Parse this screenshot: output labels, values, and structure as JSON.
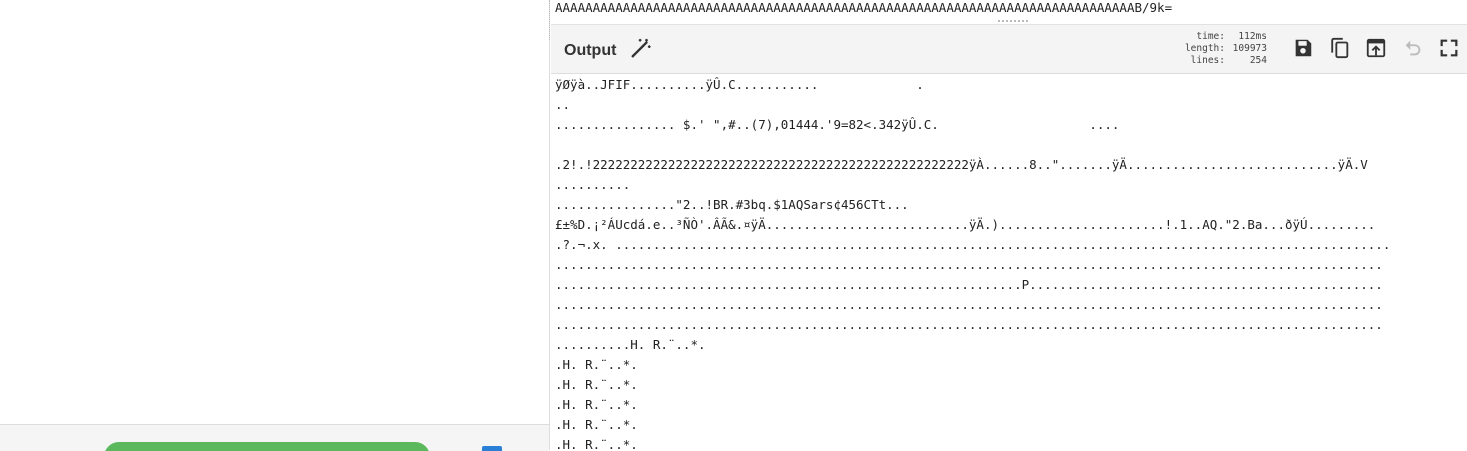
{
  "input": {
    "text": "AAAAAAAAAAAAAAAAAAAAAAAAAAAAAAAAAAAAAAAAAAAAAAAAAAAAAAAAAAAAAAAAAAAAAAAAAAAAAB/9k="
  },
  "output": {
    "title": "Output",
    "stats": {
      "time_label": "time:",
      "time_value": "112ms",
      "length_label": "length:",
      "length_value": "109973",
      "lines_label": "lines:",
      "lines_value": "254"
    },
    "icons": {
      "magic": "magic-wand-icon",
      "save": "save-icon",
      "copy": "copy-icon",
      "replace_input": "move-to-input-icon",
      "undo": "undo-icon",
      "maximise": "fullscreen-icon"
    },
    "lines": [
      "ÿØÿà..JFIF..........ÿÛ.C...........             .",
      "..",
      "................ $.' \",#..(7),01444.'9=82<.342ÿÛ.C.                    ....",
      "",
      ".2!.!22222222222222222222222222222222222222222222222222ÿÀ......8..\".......ÿÄ............................ÿÄ.V",
      "..........",
      "................\"2..!BR.#3bq.$1AQSars¢456CTt...",
      "£±%D.¡²ÁUcdá.e..³ÑÒ'.ÂÃ&.¤ÿÄ...........................ÿÄ.)......................!.1..AQ.\"2.Ba...ðÿÚ.........",
      ".?.¬.x. .......................................................................................................",
      "..............................................................................................................",
      "..............................................................P...............................................",
      "..............................................................................................................",
      "..............................................................................................................",
      "..........H. R.¨..*.",
      ".H. R.¨..*.",
      ".H. R.¨..*.",
      ".H. R.¨..*.",
      ".H. R.¨..*.",
      ".H. R.¨..*."
    ]
  },
  "colors": {
    "bake_button": "#5cb85c",
    "checkbox": "#2a7fd6"
  }
}
